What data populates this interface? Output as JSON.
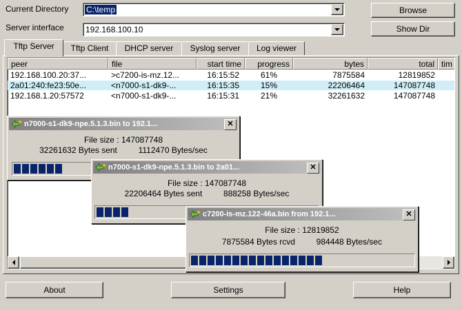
{
  "toolbar": {
    "current_directory_label": "Current Directory",
    "current_directory_value": "C:\\temp",
    "server_interface_label": "Server interface",
    "server_interface_value": "192.168.100.10",
    "browse_label": "Browse",
    "show_dir_label": "Show Dir"
  },
  "tabs": [
    {
      "label": "Tftp Server",
      "active": true
    },
    {
      "label": "Tftp Client"
    },
    {
      "label": "DHCP server"
    },
    {
      "label": "Syslog server"
    },
    {
      "label": "Log viewer"
    }
  ],
  "table": {
    "columns": [
      "peer",
      "file",
      "start time",
      "progress",
      "bytes",
      "total",
      "tim"
    ],
    "rows": [
      {
        "peer": "192.168.100.20:37...",
        "file": ">c7200-is-mz.12...",
        "start_time": "16:15:52",
        "progress": "61%",
        "bytes": "7875584",
        "total": "12819852"
      },
      {
        "peer": "2a01:240:fe23:50e...",
        "file": "<n7000-s1-dk9-...",
        "start_time": "16:15:35",
        "progress": "15%",
        "bytes": "22206464",
        "total": "147087748"
      },
      {
        "peer": "192.168.1.20:57572",
        "file": "<n7000-s1-dk9-...",
        "start_time": "16:15:31",
        "progress": "21%",
        "bytes": "32261632",
        "total": "147087748"
      }
    ]
  },
  "dialogs": [
    {
      "title": "n7000-s1-dk9-npe.5.1.3.bin to 192.1...",
      "file_size": "File size : 147087748",
      "bytes_text": "32261632 Bytes sent",
      "rate": "1112470 Bytes/sec",
      "progress": 0.21
    },
    {
      "title": "n7000-s1-dk9-npe.5.1.3.bin to 2a01...",
      "file_size": "File size : 147087748",
      "bytes_text": "22206464 Bytes sent",
      "rate": "888258 Bytes/sec",
      "progress": 0.15
    },
    {
      "title": "c7200-is-mz.122-46a.bin from 192.1...",
      "file_size": "File size : 12819852",
      "bytes_text": "7875584 Bytes rcvd",
      "rate": "984448 Bytes/sec",
      "progress": 0.61
    }
  ],
  "footer": {
    "about_label": "About",
    "settings_label": "Settings",
    "help_label": "Help"
  },
  "colors": {
    "selected_row": "#cfeef6",
    "progress_fill": "#0a246a",
    "directory_highlight": "#0a246a"
  }
}
